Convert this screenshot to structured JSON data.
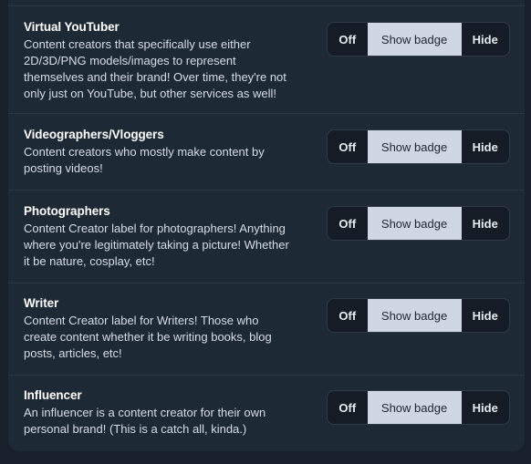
{
  "toggle_labels": {
    "off": "Off",
    "show": "Show badge",
    "hide": "Hide"
  },
  "selected_option": "Show badge",
  "labels": [
    {
      "title": "Virtual YouTuber",
      "lines": [
        "Content creators that specifically use either",
        "2D/3D/PNG models/images to represent",
        "themselves and their brand! Over time, they're not",
        "only just on YouTube, but other services as well!"
      ]
    },
    {
      "title": "Videographers/Vloggers",
      "lines": [
        "Content creators who mostly make content by",
        "posting videos!"
      ]
    },
    {
      "title": "Photographers",
      "lines": [
        "Content Creator label for photographers! Anything",
        "where you're legitimately taking a picture! Whether",
        "it be nature, cosplay, etc!"
      ]
    },
    {
      "title": "Writer",
      "lines": [
        "Content Creator label for Writers! Those who",
        "create content whether it be writing books, blog",
        "posts, articles, etc!"
      ]
    },
    {
      "title": "Influencer",
      "lines": [
        "An influencer is a content creator for their own",
        "personal brand! (This is a catch all, kinda.)"
      ]
    }
  ]
}
